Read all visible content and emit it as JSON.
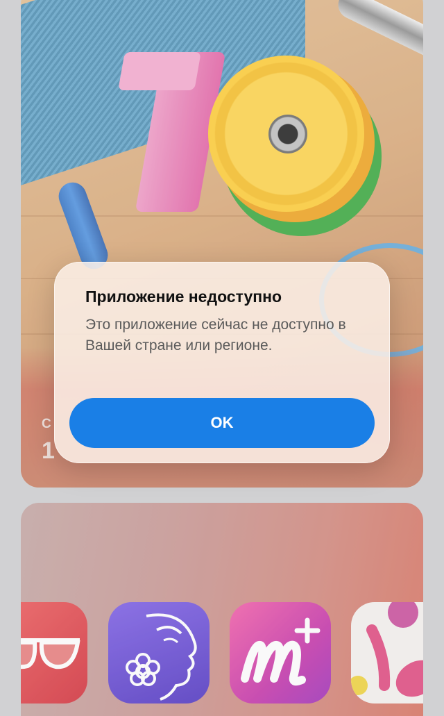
{
  "featured_card": {
    "kicker": "С",
    "title": "1"
  },
  "alert": {
    "title": "Приложение недоступно",
    "message": "Это приложение сейчас не доступно в Вашей стране или регионе.",
    "button_label": "OK"
  },
  "collection": {
    "apps": [
      {
        "icon": "sunglasses-icon",
        "color": "#e03a44"
      },
      {
        "icon": "face-flower-icon",
        "color": "#5a3ad3"
      },
      {
        "icon": "m-plus-icon",
        "color": "#d23aa9"
      },
      {
        "icon": "nail-polish-icon",
        "color": "#f4f1ee"
      }
    ]
  },
  "colors": {
    "accent": "#1a7fe6",
    "alert_background": "#fcf0e8"
  }
}
